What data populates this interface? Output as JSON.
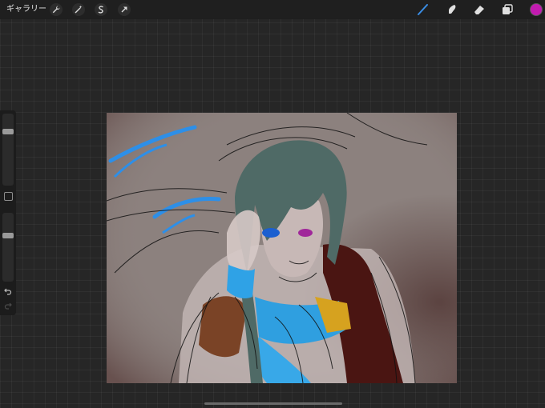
{
  "toolbar": {
    "gallery_label": "ギャラリー",
    "left_tools": [
      {
        "name": "actions-wrench-icon"
      },
      {
        "name": "adjustments-wand-icon"
      },
      {
        "name": "selection-s-icon"
      },
      {
        "name": "transform-arrow-icon"
      }
    ],
    "right_tools": [
      {
        "name": "brush-icon",
        "active": true
      },
      {
        "name": "smudge-icon"
      },
      {
        "name": "eraser-icon"
      },
      {
        "name": "layers-icon"
      }
    ],
    "current_color": "#c21bb0",
    "active_tool_color": "#3a8ee6"
  },
  "sidebar": {
    "brush_size_level": 0.23,
    "opacity_level": 0.32
  },
  "canvas": {
    "background": "#8a7f7c"
  }
}
